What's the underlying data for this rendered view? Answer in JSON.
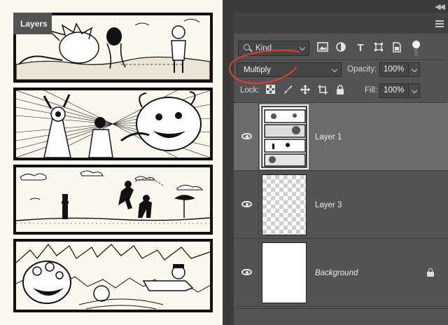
{
  "layers_panel": {
    "tab_label": "Layers",
    "collapse_icon": "double-chevron-left-icon",
    "menu_icon": "hamburger-menu-icon",
    "filter": {
      "kind_label": "Kind",
      "icons": [
        "image-filter-icon",
        "adjustment-filter-icon",
        "type-filter-icon",
        "shape-filter-icon",
        "smart-object-filter-icon"
      ]
    },
    "blend_mode": "Multiply",
    "opacity_label": "Opacity:",
    "opacity_value": "100%",
    "lock_label": "Lock:",
    "lock_icons": [
      "lock-transparent-pixels-icon",
      "lock-image-pixels-icon",
      "lock-position-icon",
      "lock-artboard-icon",
      "lock-all-icon"
    ],
    "fill_label": "Fill:",
    "fill_value": "100%",
    "layers": [
      {
        "name": "Layer 1",
        "selected": true,
        "visible": true
      },
      {
        "name": "Layer 3",
        "selected": false,
        "visible": true
      },
      {
        "name": "Background",
        "selected": false,
        "visible": true,
        "locked": true
      }
    ]
  },
  "comic_page": {
    "panels": 4
  },
  "colors": {
    "panel_bg": "#535353",
    "selected_row": "#6b6b6b",
    "annotation_red": "#d9402a",
    "paper": "#fbf8ef"
  }
}
